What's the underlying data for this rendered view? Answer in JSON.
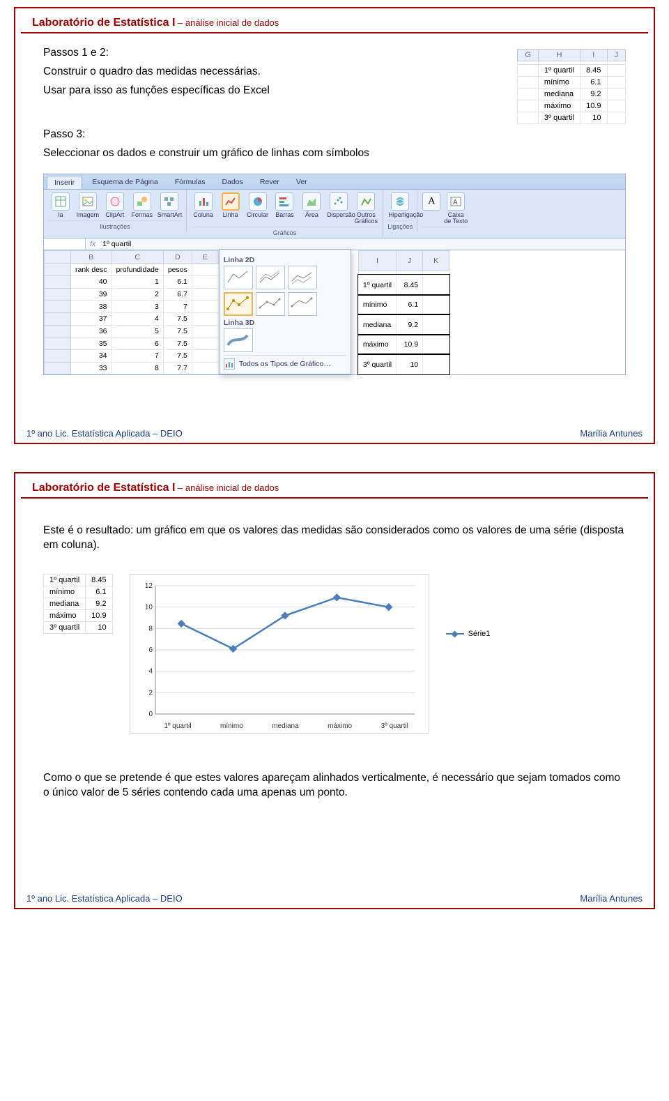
{
  "header": {
    "title_main": "Laboratório de Estatística I",
    "title_sep": " – ",
    "title_sub": "análise inicial de dados"
  },
  "footer": {
    "left": "1º ano Lic. Estatística Aplicada – DEIO",
    "right": "Marília Antunes"
  },
  "slide1": {
    "p1": "Passos 1 e 2:",
    "p2": "Construir o quadro das medidas necessárias.",
    "p3": "Usar para isso as funções específicas do Excel",
    "p4": "Passo 3:",
    "p5": "Seleccionar os dados e construir um gráfico de linhas com símbolos",
    "mini_cols": [
      "G",
      "H",
      "I",
      "J"
    ],
    "stats": [
      {
        "label": "1º quartil",
        "val": "8.45"
      },
      {
        "label": "mínimo",
        "val": "6.1"
      },
      {
        "label": "mediana",
        "val": "9.2"
      },
      {
        "label": "máximo",
        "val": "10.9"
      },
      {
        "label": "3º quartil",
        "val": "10"
      }
    ],
    "ribbon": {
      "tabs": [
        "Inserir",
        "Esquema de Página",
        "Fórmulas",
        "Dados",
        "Rever",
        "Ver"
      ],
      "active_tab_index": 0,
      "illus": {
        "items": [
          "la",
          "Imagem",
          "ClipArt",
          "Formas",
          "SmartArt"
        ],
        "label": "Ilustrações"
      },
      "charts": {
        "items": [
          "Coluna",
          "Linha",
          "Circular",
          "Barras",
          "Área",
          "Dispersão",
          "Outros Gráficos"
        ],
        "label": "Gráficos",
        "selected_index": 1
      },
      "links": {
        "items": [
          "Hiperligação"
        ],
        "label": "Ligações"
      },
      "text": {
        "items": [
          "Caixa de Texto"
        ],
        "label": ""
      },
      "a_glyph": "A"
    },
    "dropdown": {
      "sect1": "Linha 2D",
      "sect2": "Linha 3D",
      "foot": "Todos os Tipos de Gráfico…"
    },
    "fx": {
      "name": "",
      "label": "fx",
      "value": "1º quartil"
    },
    "sheet_left": {
      "cols": [
        "B",
        "C",
        "D",
        "E"
      ],
      "header_row": [
        "rank desc",
        "profundidade",
        "pesos",
        ""
      ],
      "rows": [
        [
          "40",
          "1",
          "6.1"
        ],
        [
          "39",
          "2",
          "6.7"
        ],
        [
          "38",
          "3",
          "7"
        ],
        [
          "37",
          "4",
          "7.5"
        ],
        [
          "36",
          "5",
          "7.5"
        ],
        [
          "35",
          "6",
          "7.5"
        ],
        [
          "34",
          "7",
          "7.5"
        ],
        [
          "33",
          "8",
          "7.7"
        ]
      ]
    },
    "sheet_right": {
      "cols": [
        "I",
        "J",
        "K"
      ],
      "rows": [
        [
          "1º quartil",
          "8.45"
        ],
        [
          "mínimo",
          "6.1"
        ],
        [
          "mediana",
          "9.2"
        ],
        [
          "máximo",
          "10.9"
        ],
        [
          "3º quartil",
          "10"
        ]
      ]
    }
  },
  "slide2": {
    "p1": "Este é o resultado: um gráfico em que os valores das medidas são considerados como os valores de uma série (disposta em coluna).",
    "p2": "Como o que se pretende é que estes valores apareçam alinhados verticalmente, é necessário que sejam tomados como o único valor de 5 séries contendo cada uma apenas um ponto.",
    "stats": [
      {
        "label": "1º quartil",
        "val": "8.45"
      },
      {
        "label": "mínimo",
        "val": "6.1"
      },
      {
        "label": "mediana",
        "val": "9.2"
      },
      {
        "label": "máximo",
        "val": "10.9"
      },
      {
        "label": "3º quartil",
        "val": "10"
      }
    ],
    "legend": "Série1"
  },
  "chart_data": {
    "type": "line",
    "categories": [
      "1º quartil",
      "mínimo",
      "mediana",
      "máximo",
      "3º quartil"
    ],
    "values": [
      8.45,
      6.1,
      9.2,
      10.9,
      10
    ],
    "title": "",
    "xlabel": "",
    "ylabel": "",
    "ylim": [
      0,
      12
    ],
    "yticks": [
      0,
      2,
      4,
      6,
      8,
      10,
      12
    ],
    "series_name": "Série1"
  }
}
